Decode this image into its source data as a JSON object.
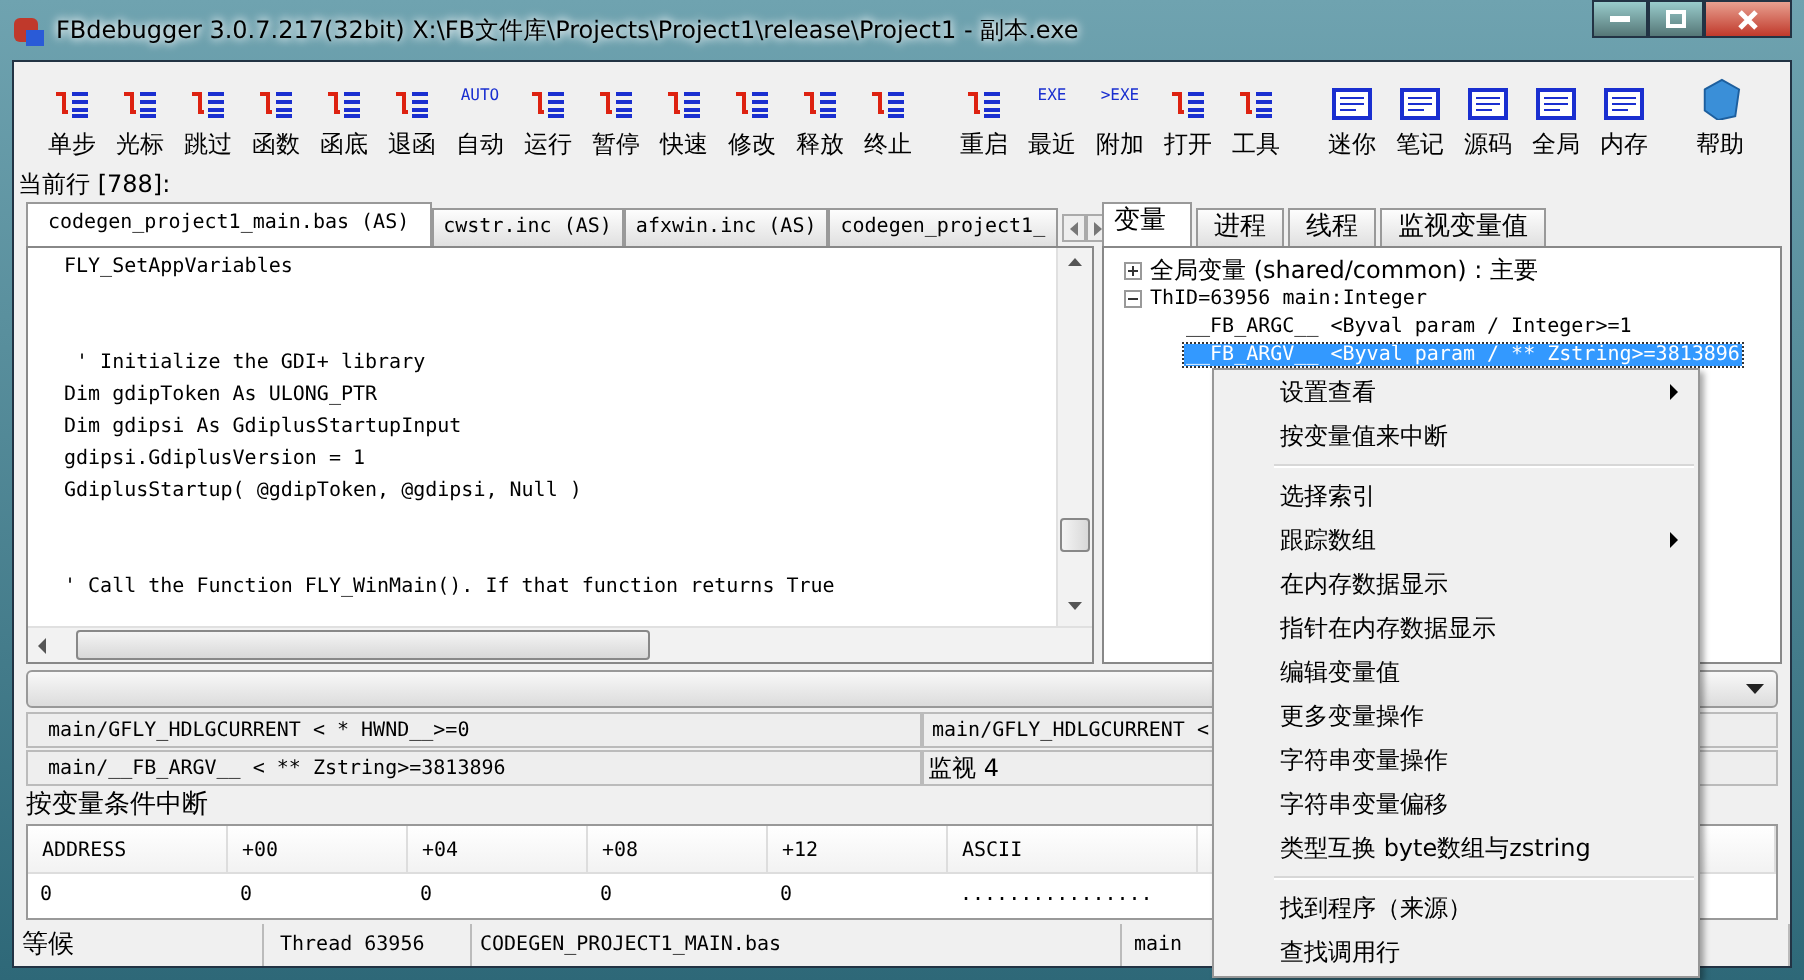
{
  "window": {
    "title": "FBdebugger 3.0.7.217(32bit) X:\\FB文件库\\Projects\\Project1\\release\\Project1 - 副本.exe"
  },
  "toolbar": [
    [
      {
        "label": "单步"
      },
      {
        "label": "光标"
      },
      {
        "label": "跳过"
      },
      {
        "label": "函数"
      },
      {
        "label": "函底"
      },
      {
        "label": "退函"
      },
      {
        "label": "自动",
        "icon_text": "AUTO"
      },
      {
        "label": "运行"
      },
      {
        "label": "暂停"
      },
      {
        "label": "快速"
      },
      {
        "label": "修改"
      },
      {
        "label": "释放"
      },
      {
        "label": "终止"
      }
    ],
    [
      {
        "label": "重启"
      },
      {
        "label": "最近",
        "icon_text": "EXE"
      },
      {
        "label": "附加",
        "icon_text": ">EXE"
      },
      {
        "label": "打开"
      },
      {
        "label": "工具"
      }
    ],
    [
      {
        "label": "迷你"
      },
      {
        "label": "笔记"
      },
      {
        "label": "源码"
      },
      {
        "label": "全局"
      },
      {
        "label": "内存"
      }
    ],
    [
      {
        "label": "帮助"
      }
    ]
  ],
  "current_line": "当前行 [788]:",
  "editor": {
    "tabs": [
      {
        "label": "codegen_project1_main.bas (AS)",
        "selected": true
      },
      {
        "label": "cwstr.inc (AS)",
        "selected": false
      },
      {
        "label": "afxwin.inc (AS)",
        "selected": false
      },
      {
        "label": "codegen_project1_",
        "selected": false
      }
    ],
    "code_blocks": [
      [
        "FLY_SetAppVariables"
      ],
      [
        " ' Initialize the GDI+ library",
        "Dim gdipToken As ULONG_PTR",
        "Dim gdipsi As GdiplusStartupInput",
        "gdipsi.GdiplusVersion = 1",
        "GdiplusStartup( @gdipToken, @gdipsi, Null )"
      ],
      [
        "' Call the Function FLY_WinMain(). If that function returns True"
      ]
    ]
  },
  "variables_panel": {
    "tabs": [
      {
        "label": "变量",
        "selected": true
      },
      {
        "label": "进程",
        "selected": false
      },
      {
        "label": "线程",
        "selected": false
      },
      {
        "label": "监视变量值",
        "selected": false
      }
    ],
    "tree": [
      {
        "label": "全局变量 (shared/common) : 主要",
        "expanded": false,
        "selected": false
      },
      {
        "label": "ThID=63956 main:Integer",
        "expanded": true,
        "selected": false,
        "children": [
          {
            "label": "__FB_ARGC__ <Byval param / Integer>=1",
            "selected": false
          },
          {
            "label": "__FB_ARGV__ <Byval param / ** Zstring>=3813896",
            "selected": true
          }
        ]
      }
    ]
  },
  "watches": [
    {
      "left": "main/GFLY_HDLGCURRENT < * HWND__>=0",
      "right": "main/GFLY_HDLGCURRENT <"
    },
    {
      "left": "main/__FB_ARGV__ < ** Zstring>=3813896",
      "right": "监视 4"
    }
  ],
  "break_on_condition": "按变量条件中断",
  "memory": {
    "columns": [
      "ADDRESS",
      "+00",
      "+04",
      "+08",
      "+12",
      "ASCII"
    ],
    "rows": [
      [
        "0",
        "0",
        "0",
        "0",
        "0",
        "................"
      ]
    ]
  },
  "status_bar": [
    "等候",
    "Thread 63956",
    "CODEGEN_PROJECT1_MAIN.bas",
    "main"
  ],
  "context_menu": [
    {
      "kind": "item",
      "label": "设置查看",
      "has_submenu": true
    },
    {
      "kind": "item",
      "label": "按变量值来中断",
      "has_submenu": false
    },
    {
      "kind": "separator"
    },
    {
      "kind": "item",
      "label": "选择索引",
      "has_submenu": false
    },
    {
      "kind": "item",
      "label": "跟踪数组",
      "has_submenu": true
    },
    {
      "kind": "item",
      "label": "在内存数据显示",
      "has_submenu": false
    },
    {
      "kind": "item",
      "label": "指针在内存数据显示",
      "has_submenu": false
    },
    {
      "kind": "item",
      "label": "编辑变量值",
      "has_submenu": false
    },
    {
      "kind": "item",
      "label": "更多变量操作",
      "has_submenu": false
    },
    {
      "kind": "item",
      "label": "字符串变量操作",
      "has_submenu": false
    },
    {
      "kind": "item",
      "label": "字符串变量偏移",
      "has_submenu": false
    },
    {
      "kind": "item",
      "label": "类型互换 byte数组与zstring",
      "has_submenu": false
    },
    {
      "kind": "separator"
    },
    {
      "kind": "item",
      "label": "找到程序（来源）",
      "has_submenu": false
    },
    {
      "kind": "item",
      "label": "查找调用行",
      "has_submenu": false
    }
  ]
}
